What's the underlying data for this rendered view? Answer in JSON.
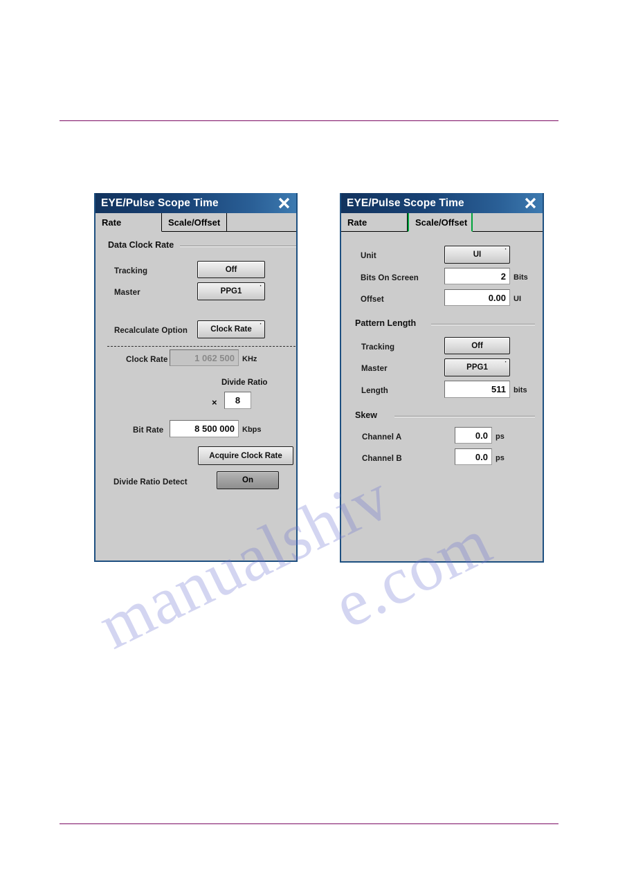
{
  "page": {
    "rule_color": "#7b0a63",
    "watermark_line1": "manualshiv",
    "watermark_line2": "e.com"
  },
  "dialog_rate": {
    "title": "EYE/Pulse Scope Time",
    "close_icon": "close-icon",
    "tabs": [
      {
        "label": "Rate",
        "active": true
      },
      {
        "label": "Scale/Offset",
        "active": false
      }
    ],
    "group_data_clock_rate": "Data Clock Rate",
    "tracking_label": "Tracking",
    "tracking_value": "Off",
    "master_label": "Master",
    "master_value": "PPG1",
    "recalculate_label": "Recalculate Option",
    "recalculate_value": "Clock Rate",
    "clock_rate_label": "Clock Rate",
    "clock_rate_value": "1 062 500",
    "clock_rate_unit": "KHz",
    "divide_ratio_label": "Divide Ratio",
    "divide_ratio_mult": "×",
    "divide_ratio_value": "8",
    "bit_rate_label": "Bit Rate",
    "bit_rate_value": "8 500 000",
    "bit_rate_unit": "Kbps",
    "acquire_button": "Acquire Clock Rate",
    "divide_ratio_detect_label": "Divide Ratio Detect",
    "divide_ratio_detect_value": "On"
  },
  "dialog_scale": {
    "title": "EYE/Pulse Scope Time",
    "close_icon": "close-icon",
    "tabs": [
      {
        "label": "Rate",
        "active": false
      },
      {
        "label": "Scale/Offset",
        "active": true
      }
    ],
    "accent_color": "#00a33c",
    "unit_label": "Unit",
    "unit_value": "UI",
    "bits_on_screen_label": "Bits On Screen",
    "bits_on_screen_value": "2",
    "bits_on_screen_unit": "Bits",
    "offset_label": "Offset",
    "offset_value": "0.00",
    "offset_unit": "UI",
    "group_pattern_length": "Pattern Length",
    "tracking_label": "Tracking",
    "tracking_value": "Off",
    "master_label": "Master",
    "master_value": "PPG1",
    "length_label": "Length",
    "length_value": "511",
    "length_unit": "bits",
    "group_skew": "Skew",
    "channel_a_label": "Channel A",
    "channel_a_value": "0.0",
    "channel_a_unit": "ps",
    "channel_b_label": "Channel B",
    "channel_b_value": "0.0",
    "channel_b_unit": "ps"
  }
}
